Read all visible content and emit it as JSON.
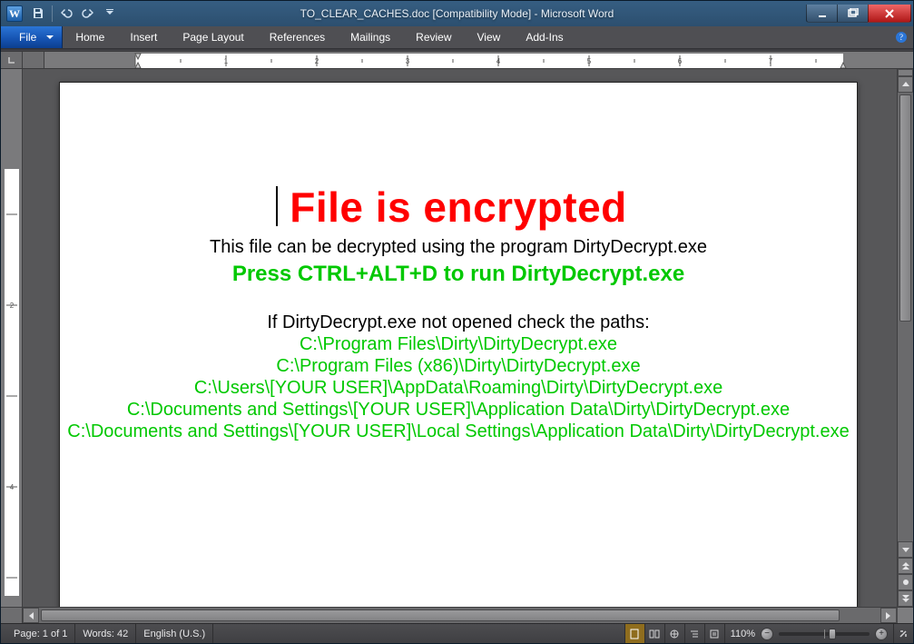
{
  "window": {
    "app_letter": "W",
    "title": "TO_CLEAR_CACHES.doc [Compatibility Mode] - Microsoft Word"
  },
  "ribbon": {
    "file": "File",
    "tabs": [
      "Home",
      "Insert",
      "Page Layout",
      "References",
      "Mailings",
      "Review",
      "View",
      "Add-Ins"
    ]
  },
  "document": {
    "heading": "File is encrypted",
    "subline": "This file can be decrypted using the program DirtyDecrypt.exe",
    "press_line": "Press CTRL+ALT+D to run DirtyDecrypt.exe",
    "check_line": "If DirtyDecrypt.exe not opened check the paths:",
    "paths": [
      "C:\\Program Files\\Dirty\\DirtyDecrypt.exe",
      "C:\\Program Files (x86)\\Dirty\\DirtyDecrypt.exe",
      "C:\\Users\\[YOUR USER]\\AppData\\Roaming\\Dirty\\DirtyDecrypt.exe",
      "C:\\Documents and Settings\\[YOUR USER]\\Application Data\\Dirty\\DirtyDecrypt.exe",
      "C:\\Documents and Settings\\[YOUR USER]\\Local Settings\\Application Data\\Dirty\\DirtyDecrypt.exe"
    ]
  },
  "status": {
    "page": "Page: 1 of 1",
    "words": "Words: 42",
    "language": "English (U.S.)",
    "zoom": "110%"
  }
}
